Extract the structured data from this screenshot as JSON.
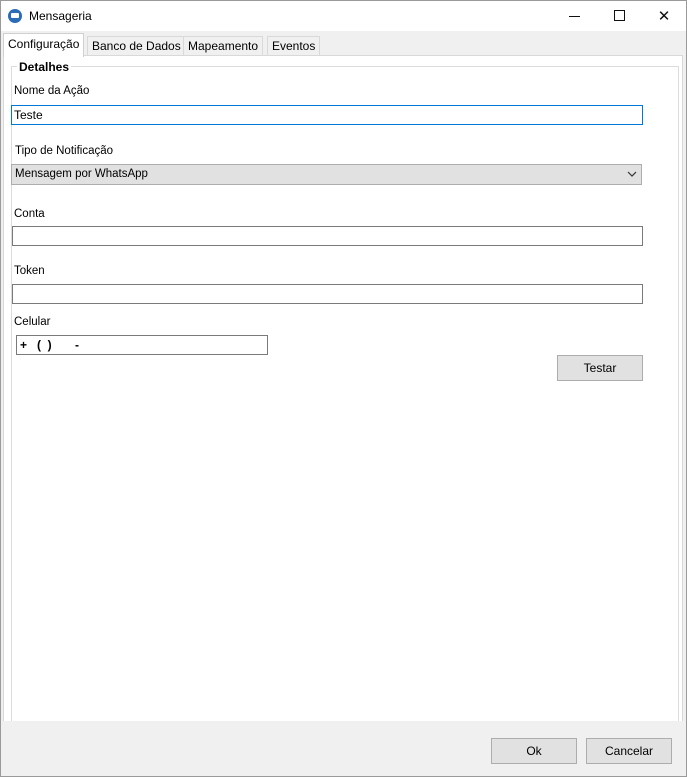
{
  "window": {
    "title": "Mensageria",
    "icon": "message-app-icon",
    "controls": {
      "minimize": "minimize-icon",
      "maximize": "maximize-icon",
      "close": "close-icon"
    }
  },
  "tabs": [
    {
      "label": "Configuração",
      "active": true
    },
    {
      "label": "Banco de Dados",
      "active": false
    },
    {
      "label": "Mapeamento",
      "active": false
    },
    {
      "label": "Eventos",
      "active": false
    }
  ],
  "details": {
    "group_title": "Detalhes",
    "action_name": {
      "label": "Nome da Ação",
      "value": "Teste"
    },
    "notification_type": {
      "label": "Tipo de Notificação",
      "selected": "Mensagem por WhatsApp"
    },
    "account": {
      "label": "Conta",
      "value": ""
    },
    "token": {
      "label": "Token",
      "value": ""
    },
    "phone": {
      "label": "Celular",
      "mask": "+   (  )       -"
    },
    "test_button": "Testar"
  },
  "footer": {
    "ok": "Ok",
    "cancel": "Cancelar"
  },
  "colors": {
    "focus_border": "#0078d7",
    "app_icon": "#2b6cb7"
  }
}
